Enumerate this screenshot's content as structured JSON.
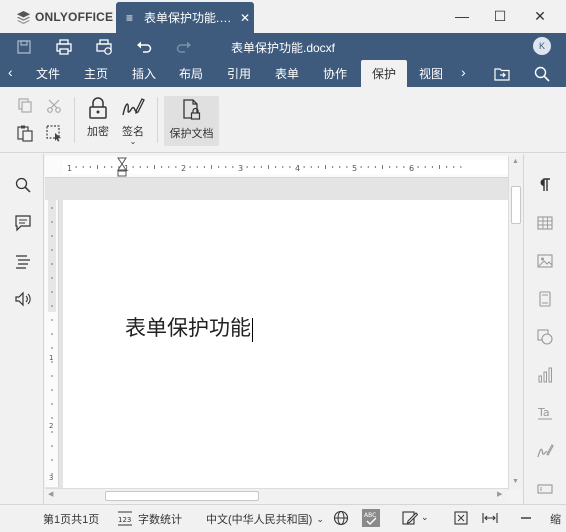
{
  "app": {
    "brand": "ONLYOFFICE"
  },
  "doc_tab": {
    "title": "表单保护功能.…",
    "menu_glyph": "≡",
    "close_glyph": "✕"
  },
  "window": {
    "minimize": "—",
    "maximize": "☐",
    "close": "✕"
  },
  "header": {
    "doc_title": "表单保护功能.docxf",
    "avatar_initial": "K"
  },
  "tabs": [
    {
      "label": "文件"
    },
    {
      "label": "主页"
    },
    {
      "label": "插入"
    },
    {
      "label": "布局"
    },
    {
      "label": "引用"
    },
    {
      "label": "表单"
    },
    {
      "label": "协作"
    },
    {
      "label": "保护",
      "active": true
    },
    {
      "label": "视图"
    }
  ],
  "ribbon": {
    "encrypt_label": "加密",
    "sign_label": "签名",
    "protect_label": "保护文档"
  },
  "document": {
    "text": "表单保护功能"
  },
  "ruler": {
    "labels": [
      "1",
      "1",
      "2",
      "3",
      "4",
      "5",
      "6"
    ],
    "vlabels": [
      "1",
      "2",
      "3"
    ]
  },
  "status": {
    "page_info": "第1页共1页",
    "word_count": "字数统计",
    "language": "中文(中华人民共和国)",
    "zoom_label": "缩"
  },
  "colors": {
    "brand_blue": "#3e5a7c",
    "bar_bg": "#f1f1f1"
  }
}
